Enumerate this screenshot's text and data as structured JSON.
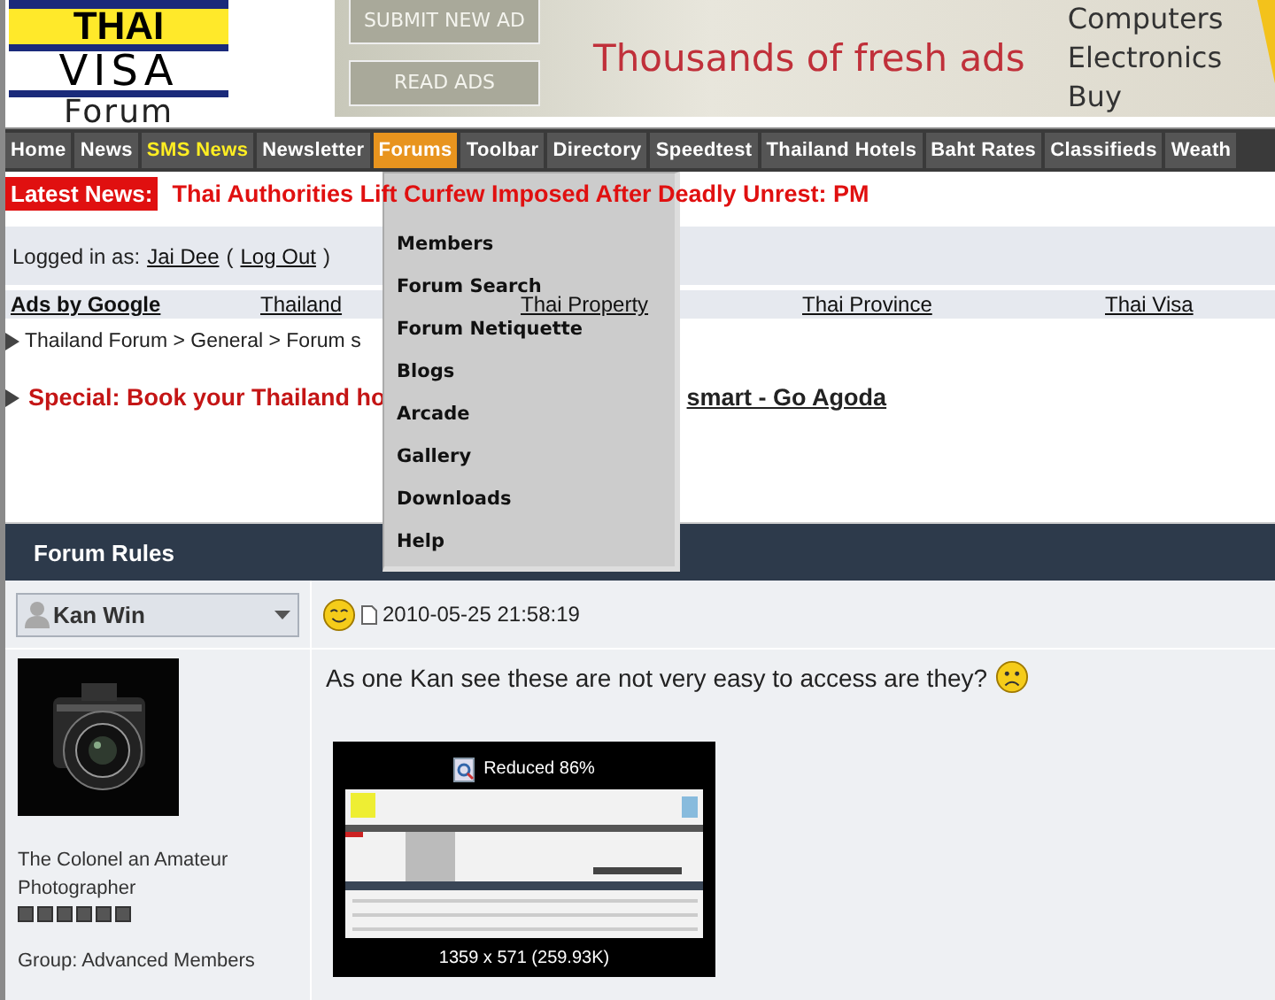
{
  "logo": {
    "line1": "THAI",
    "line2": "VISA",
    "line3": "Forum"
  },
  "banner": {
    "buttons": [
      "SUBMIT NEW AD",
      "READ ADS"
    ],
    "headline": "Thousands of fresh ads",
    "links": [
      "Computers",
      "Electronics",
      "Buy"
    ]
  },
  "nav": [
    {
      "label": "Home",
      "selected": false,
      "highlighted": false
    },
    {
      "label": "News",
      "selected": false,
      "highlighted": false
    },
    {
      "label": "SMS News",
      "selected": false,
      "highlighted": true
    },
    {
      "label": "Newsletter",
      "selected": false,
      "highlighted": false
    },
    {
      "label": "Forums",
      "selected": true,
      "highlighted": false
    },
    {
      "label": "Toolbar",
      "selected": false,
      "highlighted": false
    },
    {
      "label": "Directory",
      "selected": false,
      "highlighted": false
    },
    {
      "label": "Speedtest",
      "selected": false,
      "highlighted": false
    },
    {
      "label": "Thailand Hotels",
      "selected": false,
      "highlighted": false
    },
    {
      "label": "Baht Rates",
      "selected": false,
      "highlighted": false
    },
    {
      "label": "Classifieds",
      "selected": false,
      "highlighted": false
    },
    {
      "label": "Weath",
      "selected": false,
      "highlighted": false
    }
  ],
  "forums_menu": [
    "Members",
    "Forum Search",
    "Forum Netiquette",
    "Blogs",
    "Arcade",
    "Gallery",
    "Downloads",
    "Help"
  ],
  "latest_news": {
    "label": "Latest News:",
    "headline": "Thai Authorities Lift Curfew Imposed After Deadly Unrest: PM"
  },
  "login": {
    "prefix": "Logged in as:",
    "user": "Jai Dee",
    "logout": "Log Out",
    "open": "(",
    "close": ")"
  },
  "ads": {
    "label": "Ads by Google",
    "links": [
      "Thailand",
      "Thai Property",
      "Thai Province",
      "Thai Visa"
    ]
  },
  "breadcrumb": "Thailand Forum > General > Forum s",
  "special": {
    "text": "Special: Book your Thailand ho",
    "link": "smart - Go Agoda"
  },
  "forum_header": "Forum Rules",
  "post": {
    "author": "Kan Win",
    "timestamp": "2010-05-25 21:58:19",
    "author_title": "The Colonel an Amateur Photographer",
    "stars": 6,
    "group": "Group: Advanced Members",
    "text": "As one Kan see these are not very easy to access are they?",
    "attachment": {
      "caption": "Reduced 86%",
      "size": "1359 x 571 (259.93K)"
    }
  }
}
